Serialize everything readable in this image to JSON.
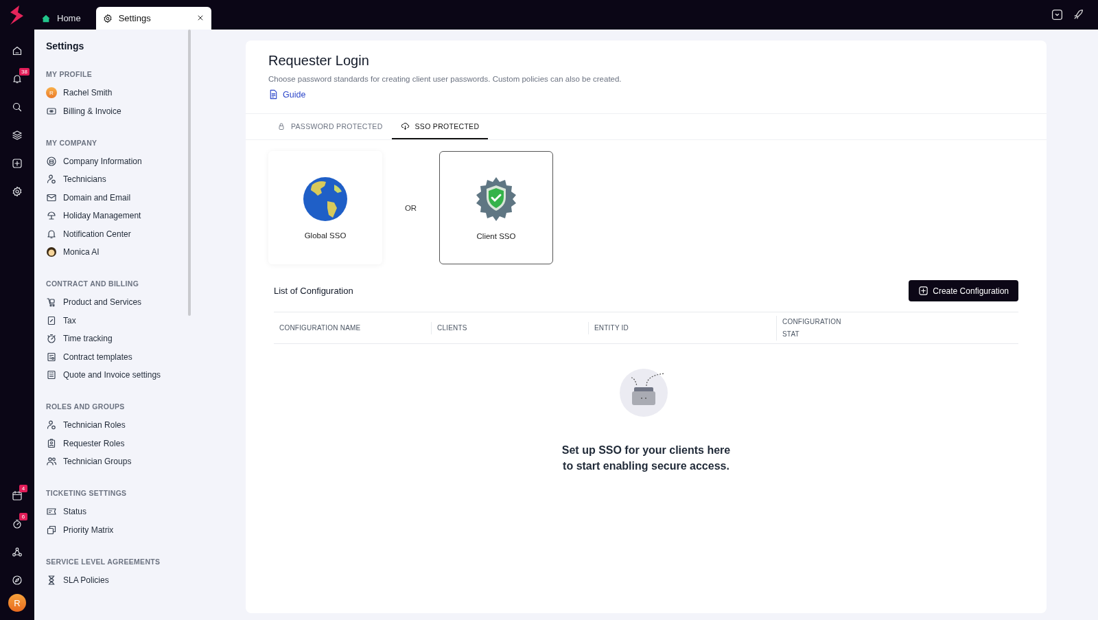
{
  "top_tabs": [
    {
      "label": "Home",
      "selected": false,
      "closable": false
    },
    {
      "label": "Settings",
      "selected": true,
      "closable": true
    }
  ],
  "rail": {
    "badges": {
      "notifications": "38",
      "calendar": "4",
      "timers": "6"
    },
    "avatar": "R"
  },
  "sidebar": {
    "title": "Settings",
    "sections": [
      {
        "title": "MY PROFILE",
        "items": [
          {
            "label": "Rachel Smith",
            "avatar": "R"
          },
          {
            "label": "Billing & Invoice"
          }
        ]
      },
      {
        "title": "MY COMPANY",
        "items": [
          {
            "label": "Company Information"
          },
          {
            "label": "Technicians"
          },
          {
            "label": "Domain and Email"
          },
          {
            "label": "Holiday Management"
          },
          {
            "label": "Notification Center"
          },
          {
            "label": "Monica AI"
          }
        ]
      },
      {
        "title": "CONTRACT AND BILLING",
        "items": [
          {
            "label": "Product and Services"
          },
          {
            "label": "Tax"
          },
          {
            "label": "Time tracking"
          },
          {
            "label": "Contract templates"
          },
          {
            "label": "Quote and Invoice settings"
          }
        ]
      },
      {
        "title": "ROLES AND GROUPS",
        "items": [
          {
            "label": "Technician Roles"
          },
          {
            "label": "Requester Roles"
          },
          {
            "label": "Technician Groups"
          }
        ]
      },
      {
        "title": "TICKETING SETTINGS",
        "items": [
          {
            "label": "Status"
          },
          {
            "label": "Priority Matrix"
          }
        ]
      },
      {
        "title": "SERVICE LEVEL AGREEMENTS",
        "items": [
          {
            "label": "SLA Policies"
          }
        ]
      }
    ]
  },
  "page": {
    "title": "Requester Login",
    "description": "Choose password standards for creating client user passwords. Custom policies can also be created.",
    "guide_link": "Guide"
  },
  "tabs": [
    {
      "label": "PASSWORD PROTECTED",
      "selected": false
    },
    {
      "label": "SSO PROTECTED",
      "selected": true
    }
  ],
  "sso_options": [
    {
      "label": "Global SSO",
      "selected": false
    },
    {
      "label": "Client SSO",
      "selected": true
    }
  ],
  "or_label": "OR",
  "list": {
    "title": "List of Configuration",
    "create_button": "Create Configuration",
    "columns": [
      "CONFIGURATION NAME",
      "CLIENTS",
      "ENTITY ID",
      "CONFIGURATION STAT"
    ],
    "empty_message": [
      "Set up SSO for your clients here",
      "to start enabling secure access."
    ]
  }
}
